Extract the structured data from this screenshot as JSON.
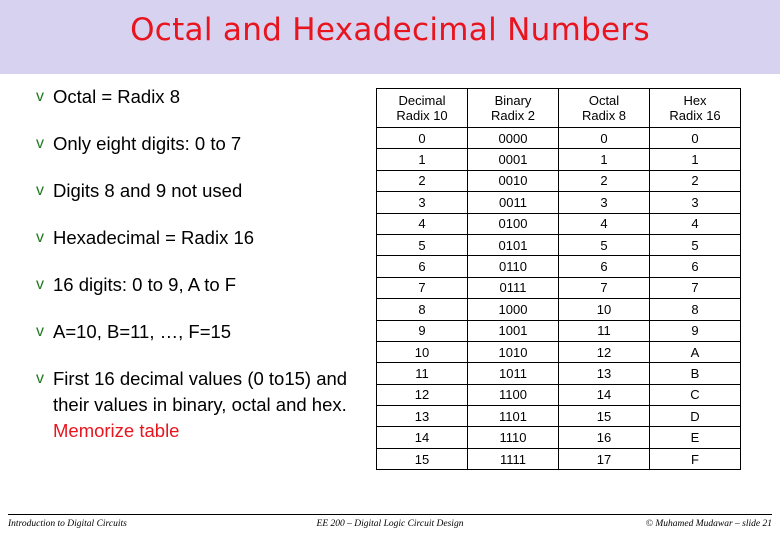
{
  "slide": {
    "title": "Octal and Hexadecimal Numbers",
    "title_color": "#e8141e",
    "band_color": "#d6d2f0"
  },
  "bullets": [
    {
      "marker": "v",
      "text": "Octal = Radix 8"
    },
    {
      "marker": "v",
      "text": "Only eight digits: 0 to 7"
    },
    {
      "marker": "v",
      "text": "Digits 8 and 9 not used"
    },
    {
      "marker": "v",
      "text": "Hexadecimal = Radix 16"
    },
    {
      "marker": "v",
      "text": "16 digits: 0 to 9, A to F"
    },
    {
      "marker": "v",
      "text": "A=10, B=11, …, F=15"
    },
    {
      "marker": "v",
      "text": "First 16 decimal values (0 to15) and their values in binary, octal and hex. ",
      "highlight": "Memorize table",
      "highlight_color": "#e8141e"
    }
  ],
  "table": {
    "headers": [
      {
        "line1": "Decimal",
        "line2": "Radix 10"
      },
      {
        "line1": "Binary",
        "line2": "Radix 2"
      },
      {
        "line1": "Octal",
        "line2": "Radix 8"
      },
      {
        "line1": "Hex",
        "line2": "Radix 16"
      }
    ],
    "rows": [
      [
        "0",
        "0000",
        "0",
        "0"
      ],
      [
        "1",
        "0001",
        "1",
        "1"
      ],
      [
        "2",
        "0010",
        "2",
        "2"
      ],
      [
        "3",
        "0011",
        "3",
        "3"
      ],
      [
        "4",
        "0100",
        "4",
        "4"
      ],
      [
        "5",
        "0101",
        "5",
        "5"
      ],
      [
        "6",
        "0110",
        "6",
        "6"
      ],
      [
        "7",
        "0111",
        "7",
        "7"
      ],
      [
        "8",
        "1000",
        "10",
        "8"
      ],
      [
        "9",
        "1001",
        "11",
        "9"
      ],
      [
        "10",
        "1010",
        "12",
        "A"
      ],
      [
        "11",
        "1011",
        "13",
        "B"
      ],
      [
        "12",
        "1100",
        "14",
        "C"
      ],
      [
        "13",
        "1101",
        "15",
        "D"
      ],
      [
        "14",
        "1110",
        "16",
        "E"
      ],
      [
        "15",
        "1111",
        "17",
        "F"
      ]
    ]
  },
  "footer": {
    "left": "Introduction to Digital Circuits",
    "center": "EE 200 – Digital Logic Circuit Design",
    "right": "© Muhamed Mudawar – slide 21"
  }
}
